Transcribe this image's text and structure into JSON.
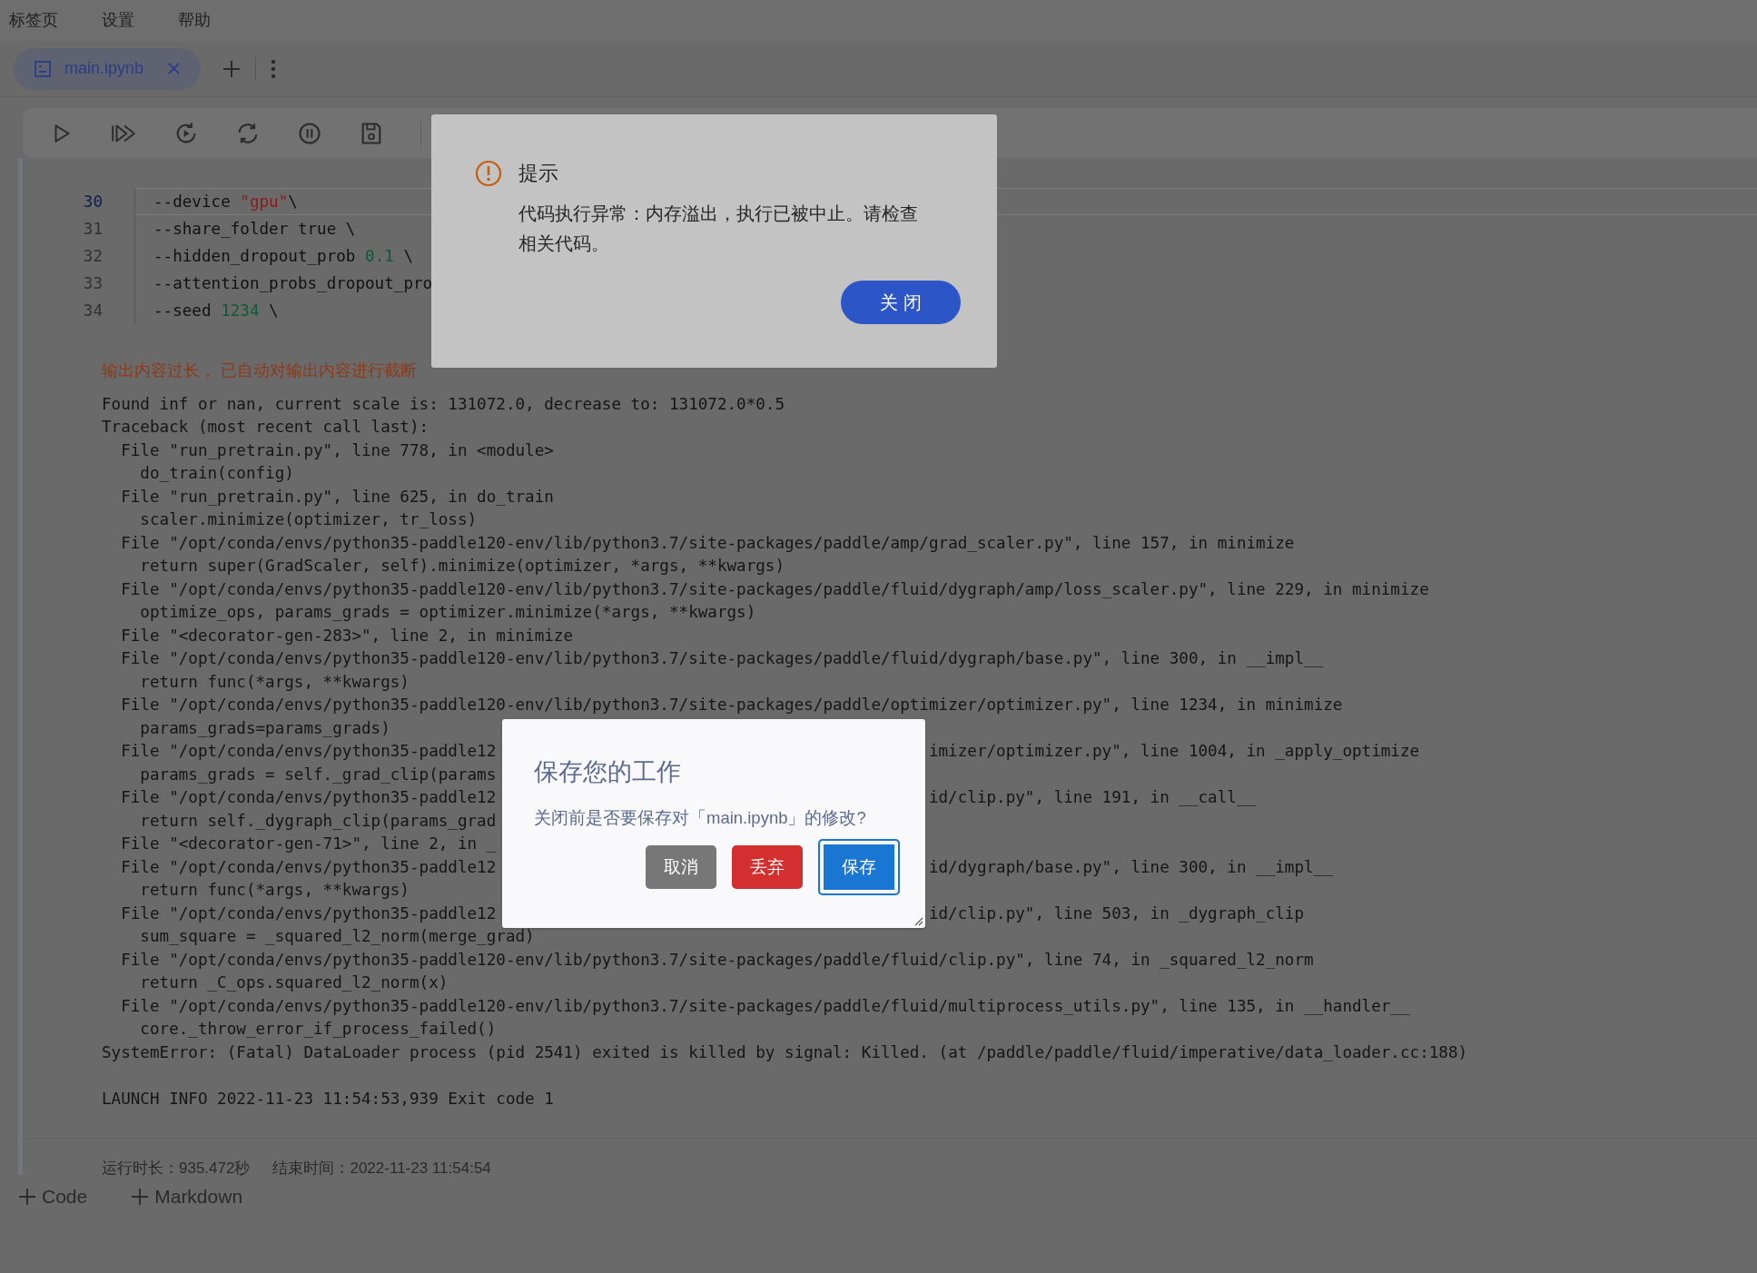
{
  "menu": [
    "标签页",
    "设置",
    "帮助"
  ],
  "tabs": [
    {
      "label": "main.ipynb",
      "selected": true
    }
  ],
  "code_cell": {
    "lines": [
      {
        "number": "30",
        "active": true,
        "tokens": [
          {
            "text": "--device ",
            "kind": "plain"
          },
          {
            "text": "\"gpu\"",
            "kind": "string"
          },
          {
            "text": "\\",
            "kind": "plain"
          }
        ]
      },
      {
        "number": "31",
        "active": false,
        "tokens": [
          {
            "text": "--share_folder true \\",
            "kind": "plain"
          }
        ]
      },
      {
        "number": "32",
        "active": false,
        "tokens": [
          {
            "text": "--hidden_dropout_prob ",
            "kind": "plain"
          },
          {
            "text": "0.1",
            "kind": "number"
          },
          {
            "text": " \\",
            "kind": "plain"
          }
        ]
      },
      {
        "number": "33",
        "active": false,
        "tokens": [
          {
            "text": "--attention_probs_dropout_pro",
            "kind": "plain"
          }
        ]
      },
      {
        "number": "34",
        "active": false,
        "tokens": [
          {
            "text": "--seed ",
            "kind": "plain"
          },
          {
            "text": "1234",
            "kind": "number"
          },
          {
            "text": " \\",
            "kind": "plain"
          }
        ]
      }
    ]
  },
  "output": {
    "notice": "输出内容过长， 已自动对输出内容进行截断",
    "lines": [
      {
        "text": "Found inf or nan, current scale is: 131072.0, decrease to: 131072.0*0.5"
      },
      {
        "text": "Traceback (most recent call last):"
      },
      {
        "text": "  File \"run_pretrain.py\", line 778, in <module>"
      },
      {
        "text": "    do_train(config)"
      },
      {
        "text": "  File \"run_pretrain.py\", line 625, in do_train"
      },
      {
        "text": "    scaler.minimize(optimizer, tr_loss)"
      },
      {
        "text": "  File \"/opt/conda/envs/python35-paddle120-env/lib/python3.7/site-packages/paddle/amp/grad_scaler.py\", line 157, in minimize"
      },
      {
        "text": "    return super(GradScaler, self).minimize(optimizer, *args, **kwargs)"
      },
      {
        "text": "  File \"/opt/conda/envs/python35-paddle120-env/lib/python3.7/site-packages/paddle/fluid/dygraph/amp/loss_scaler.py\", line 229, in minimize"
      },
      {
        "text": "    optimize_ops, params_grads = optimizer.minimize(*args, **kwargs)"
      },
      {
        "text": "  File \"<decorator-gen-283>\", line 2, in minimize"
      },
      {
        "text": "  File \"/opt/conda/envs/python35-paddle120-env/lib/python3.7/site-packages/paddle/fluid/dygraph/base.py\", line 300, in __impl__"
      },
      {
        "text": "    return func(*args, **kwargs)"
      },
      {
        "text": "  File \"/opt/conda/envs/python35-paddle120-env/lib/python3.7/site-packages/paddle/optimizer/optimizer.py\", line 1234, in minimize"
      },
      {
        "text": "    params_grads=params_grads)"
      },
      {
        "text": "  File \"/opt/conda/envs/python35-paddle12",
        "right": "imizer/optimizer.py\", line 1004, in _apply_optimize"
      },
      {
        "text": "    params_grads = self._grad_clip(params"
      },
      {
        "text": "  File \"/opt/conda/envs/python35-paddle12",
        "right": "id/clip.py\", line 191, in __call__"
      },
      {
        "text": "    return self._dygraph_clip(params_grad"
      },
      {
        "text": "  File \"<decorator-gen-71>\", line 2, in _"
      },
      {
        "text": "  File \"/opt/conda/envs/python35-paddle12",
        "right": "id/dygraph/base.py\", line 300, in __impl__"
      },
      {
        "text": "    return func(*args, **kwargs)"
      },
      {
        "text": "  File \"/opt/conda/envs/python35-paddle12",
        "right": "id/clip.py\", line 503, in _dygraph_clip"
      },
      {
        "text": "    sum_square = _squared_l2_norm(merge_grad)"
      },
      {
        "text": "  File \"/opt/conda/envs/python35-paddle120-env/lib/python3.7/site-packages/paddle/fluid/clip.py\", line 74, in _squared_l2_norm"
      },
      {
        "text": "    return _C_ops.squared_l2_norm(x)"
      },
      {
        "text": "  File \"/opt/conda/envs/python35-paddle120-env/lib/python3.7/site-packages/paddle/fluid/multiprocess_utils.py\", line 135, in __handler__"
      },
      {
        "text": "    core._throw_error_if_process_failed()"
      },
      {
        "text": "SystemError: (Fatal) DataLoader process (pid 2541) exited is killed by signal: Killed. (at /paddle/paddle/fluid/imperative/data_loader.cc:188)"
      }
    ],
    "exit_message": "LAUNCH INFO 2022-11-23 11:54:53,939 Exit code 1"
  },
  "status": {
    "runtime": "运行时长：935.472秒",
    "end_time": "结束时间：2022-11-23 11:54:54"
  },
  "add_buttons": [
    "Code",
    "Markdown"
  ],
  "alert_dialog": {
    "title": "提示",
    "message": "代码执行异常：内存溢出，执行已被中止。请检查相关代码。",
    "button": "关 闭"
  },
  "save_dialog": {
    "title": "保存您的工作",
    "message": "关闭前是否要保存对「main.ipynb」的修改?",
    "buttons": [
      {
        "label": "取消",
        "kind": "secondary",
        "focused": false
      },
      {
        "label": "丢弃",
        "kind": "danger",
        "focused": false
      },
      {
        "label": "保存",
        "kind": "primary",
        "focused": true
      }
    ]
  }
}
